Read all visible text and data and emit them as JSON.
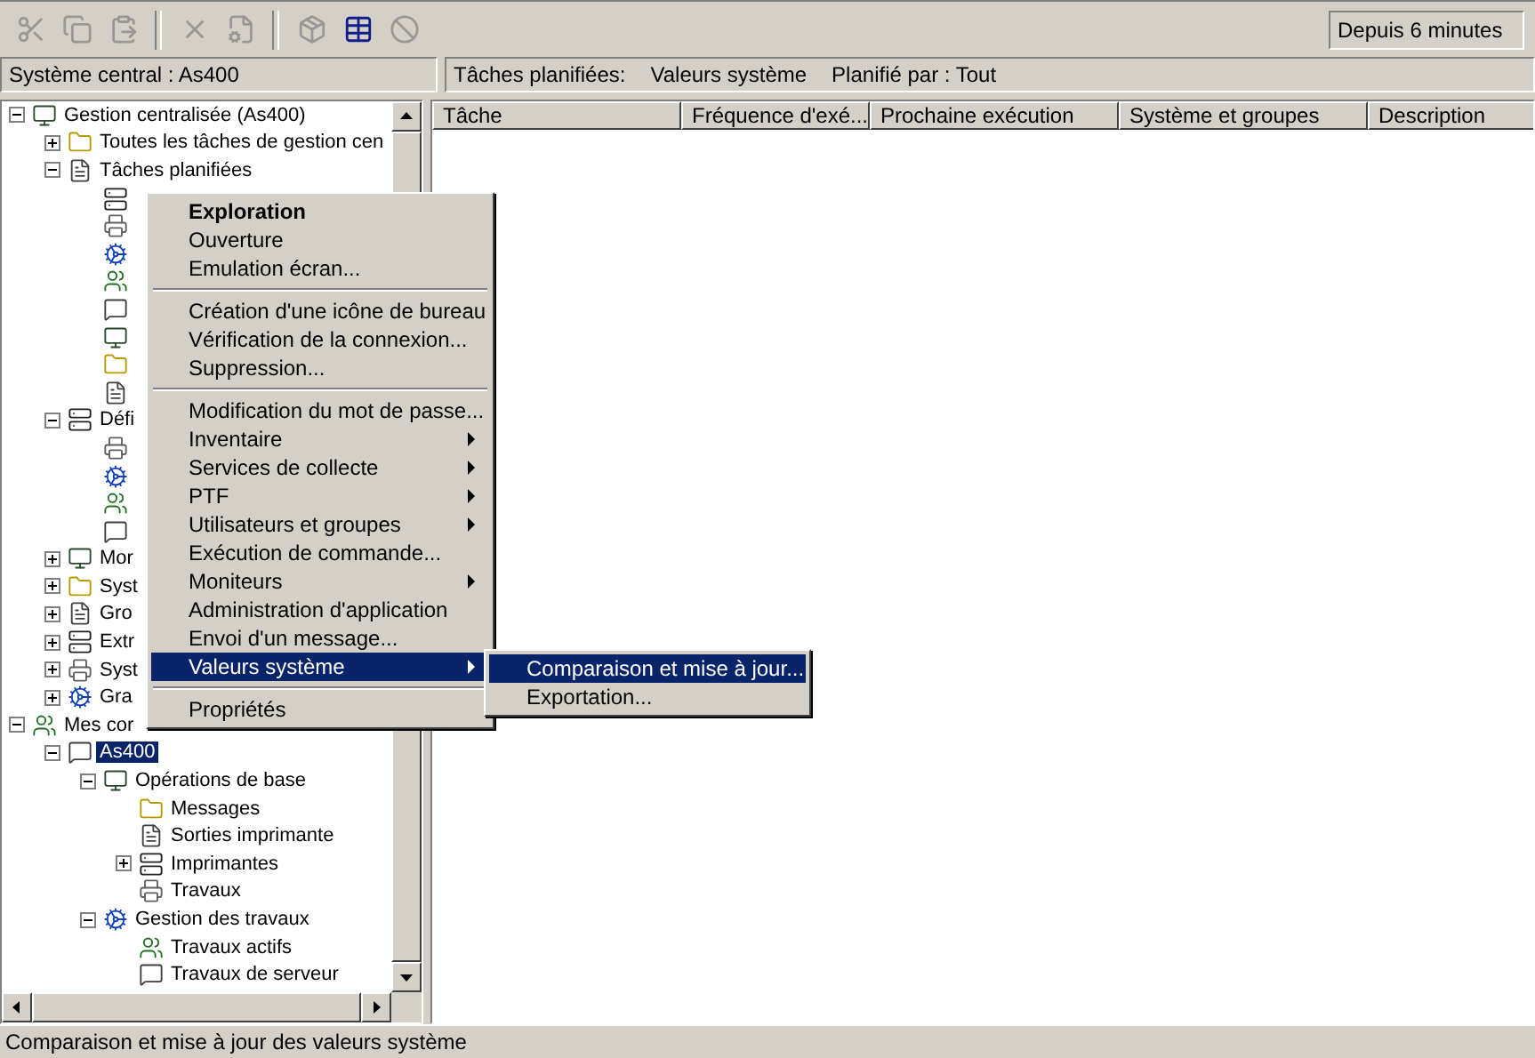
{
  "toolbar": [
    {
      "kind": "cut",
      "disabled": true
    },
    {
      "kind": "copy",
      "disabled": true
    },
    {
      "kind": "paste",
      "disabled": true
    },
    {
      "kind": "separator"
    },
    {
      "kind": "delete",
      "disabled": true
    },
    {
      "kind": "properties",
      "disabled": true
    },
    {
      "kind": "separator"
    },
    {
      "kind": "package",
      "disabled": true
    },
    {
      "kind": "table",
      "disabled": false
    },
    {
      "kind": "stop",
      "disabled": true
    }
  ],
  "status_since": "Depuis 6 minutes",
  "left_header": "Système central : As400",
  "right_header": [
    "Tâches planifiées:",
    "Valeurs système",
    "Planifié par : Tout"
  ],
  "tree": [
    {
      "label": "Gestion centralisée (As400)",
      "expanded": true,
      "selected": false,
      "children": [
        {
          "label": "Toutes les tâches de gestion cen",
          "expanded": false,
          "selected": false
        },
        {
          "label": "Tâches planifiées",
          "expanded": true,
          "selected": false,
          "children": [
            {
              "selected": false
            },
            {
              "selected": false
            },
            {
              "selected": false
            },
            {
              "selected": false
            },
            {
              "selected": false
            },
            {
              "selected": false
            },
            {
              "selected": false
            },
            {
              "selected": false
            }
          ]
        },
        {
          "label": "Défi",
          "expanded": true,
          "selected": false,
          "children": [
            {
              "selected": false
            },
            {
              "selected": false
            },
            {
              "selected": false
            },
            {
              "selected": false
            }
          ]
        },
        {
          "label": "Mor",
          "expanded": false,
          "selected": false
        },
        {
          "label": "Syst",
          "expanded": false,
          "selected": false
        },
        {
          "label": "Gro",
          "expanded": false,
          "selected": false
        },
        {
          "label": "Extr",
          "expanded": false,
          "selected": false
        },
        {
          "label": "Syst",
          "expanded": false,
          "selected": false
        },
        {
          "label": "Gra",
          "expanded": false,
          "selected": false
        }
      ]
    },
    {
      "label": "Mes cor",
      "expanded": true,
      "selected": false,
      "children": [
        {
          "label": "As400",
          "expanded": true,
          "selected": true,
          "children": [
            {
              "label": "Opérations de base",
              "expanded": true,
              "selected": false,
              "children": [
                {
                  "label": "Messages",
                  "selected": false
                },
                {
                  "label": "Sorties imprimante",
                  "selected": false
                },
                {
                  "label": "Imprimantes",
                  "expanded": false,
                  "selected": false
                },
                {
                  "label": "Travaux",
                  "selected": false
                }
              ]
            },
            {
              "label": "Gestion des travaux",
              "expanded": true,
              "selected": false,
              "children": [
                {
                  "label": "Travaux actifs",
                  "selected": false
                },
                {
                  "label": "Travaux de serveur",
                  "selected": false
                }
              ]
            }
          ]
        }
      ]
    }
  ],
  "columns": [
    "Tâche",
    "Fréquence d'exé...",
    "Prochaine exécution",
    "Système et groupes",
    "Description"
  ],
  "context_menu": {
    "sections": [
      [
        {
          "label": "Exploration",
          "default": true,
          "submenu": false,
          "selected": false
        },
        {
          "label": "Ouverture",
          "default": false,
          "submenu": false,
          "selected": false
        },
        {
          "label": "Emulation écran...",
          "default": false,
          "submenu": false,
          "selected": false
        }
      ],
      [
        {
          "label": "Création d'une icône de bureau",
          "default": false,
          "submenu": false,
          "selected": false
        },
        {
          "label": "Vérification de la connexion...",
          "default": false,
          "submenu": false,
          "selected": false
        },
        {
          "label": "Suppression...",
          "default": false,
          "submenu": false,
          "selected": false
        }
      ],
      [
        {
          "label": "Modification du mot de passe...",
          "default": false,
          "submenu": false,
          "selected": false
        },
        {
          "label": "Inventaire",
          "default": false,
          "submenu": true,
          "selected": false
        },
        {
          "label": "Services de collecte",
          "default": false,
          "submenu": true,
          "selected": false
        },
        {
          "label": "PTF",
          "default": false,
          "submenu": true,
          "selected": false
        },
        {
          "label": "Utilisateurs et groupes",
          "default": false,
          "submenu": true,
          "selected": false
        },
        {
          "label": "Exécution de commande...",
          "default": false,
          "submenu": false,
          "selected": false
        },
        {
          "label": "Moniteurs",
          "default": false,
          "submenu": true,
          "selected": false
        },
        {
          "label": "Administration d'application",
          "default": false,
          "submenu": false,
          "selected": false
        },
        {
          "label": "Envoi d'un message...",
          "default": false,
          "submenu": false,
          "selected": false
        },
        {
          "label": "Valeurs système",
          "default": false,
          "submenu": true,
          "selected": true
        }
      ],
      [
        {
          "label": "Propriétés",
          "default": false,
          "submenu": false,
          "selected": false
        }
      ]
    ]
  },
  "submenu": [
    {
      "label": "Comparaison et mise à jour...",
      "selected": true
    },
    {
      "label": "Exportation...",
      "selected": false
    }
  ],
  "status_bar": "Comparaison et mise à jour des valeurs système"
}
